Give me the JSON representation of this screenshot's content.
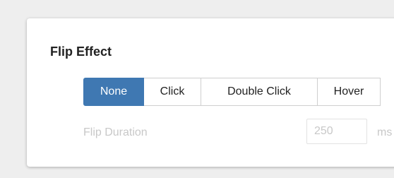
{
  "flip_effect": {
    "title": "Flip Effect",
    "options": [
      {
        "label": "None",
        "active": true
      },
      {
        "label": "Click",
        "active": false
      },
      {
        "label": "Double Click",
        "active": false
      },
      {
        "label": "Hover",
        "active": false
      }
    ]
  },
  "flip_duration": {
    "label": "Flip Duration",
    "value": "250",
    "unit": "ms",
    "disabled": true
  },
  "colors": {
    "accent": "#3f78b2",
    "disabled_text": "#c8c8c8",
    "panel_background": "#ffffff",
    "page_background": "#eeeeee"
  }
}
